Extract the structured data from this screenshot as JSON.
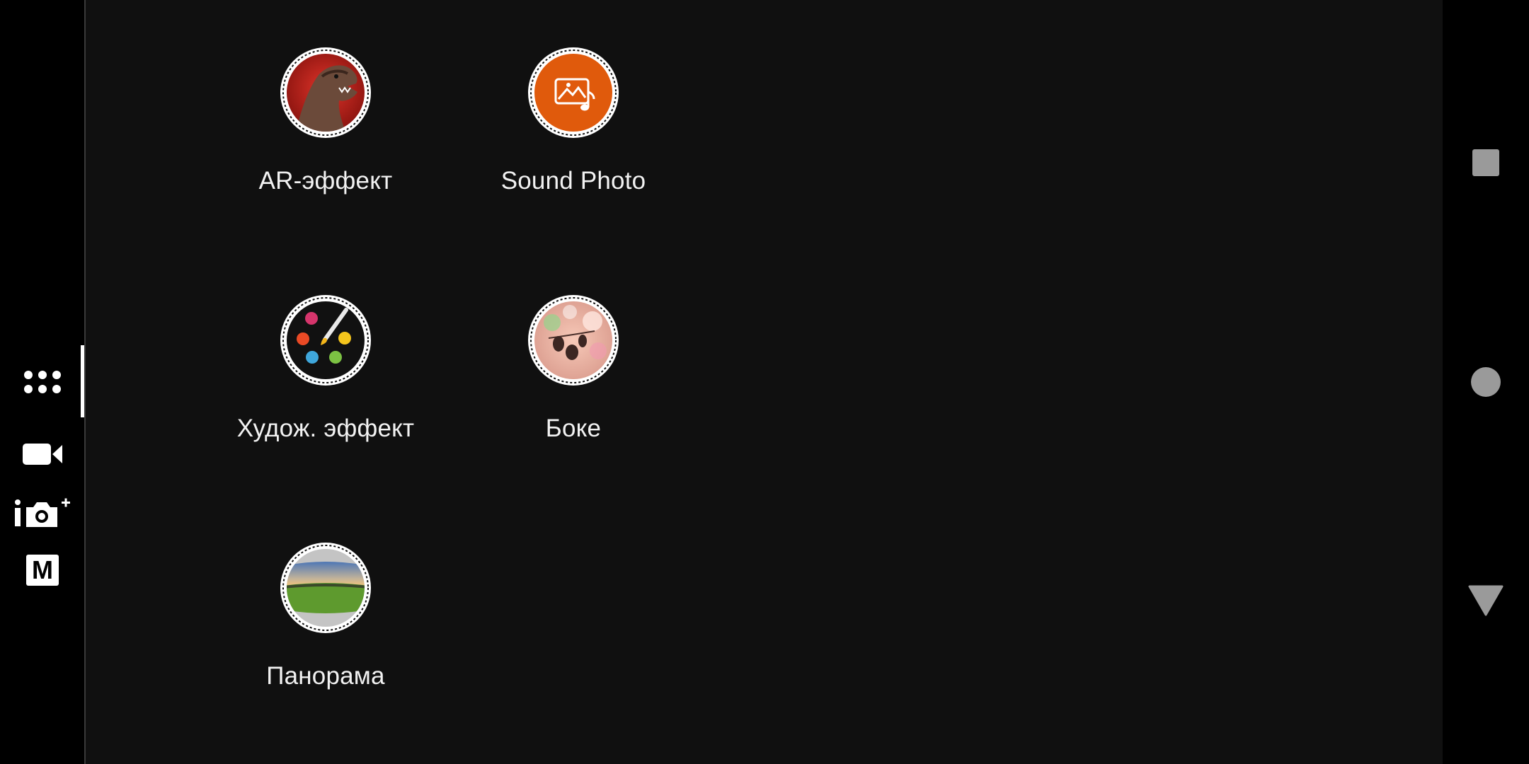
{
  "modes": [
    {
      "id": "ar",
      "label": "AR-эффект",
      "icon": "dinosaur-icon"
    },
    {
      "id": "sound",
      "label": "Sound Photo",
      "icon": "sound-photo-icon"
    },
    {
      "id": "art",
      "label": "Худож. эффект",
      "icon": "palette-icon"
    },
    {
      "id": "bokeh",
      "label": "Боке",
      "icon": "bokeh-icon"
    },
    {
      "id": "pano",
      "label": "Панорама",
      "icon": "panorama-icon"
    }
  ],
  "rail": {
    "items": [
      "apps-grid-icon",
      "video-camera-icon",
      "superior-auto-camera-icon",
      "manual-mode-icon"
    ],
    "manual_letter": "M",
    "selected": "apps-grid-icon"
  },
  "navbar": [
    "recents-icon",
    "home-icon",
    "back-icon"
  ],
  "colors": {
    "background": "#101010",
    "rail": "#000000",
    "sound_photo": "#e05a0c",
    "nav_icons": "#9a9a9a"
  }
}
